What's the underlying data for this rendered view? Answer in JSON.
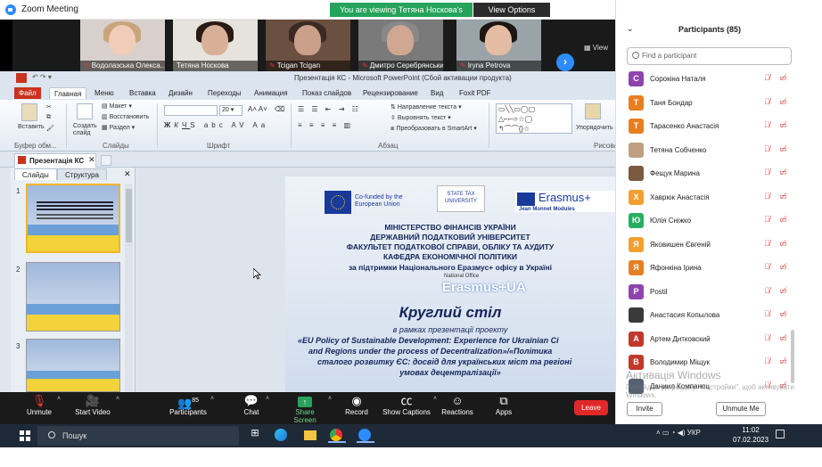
{
  "window": {
    "title": "Zoom Meeting",
    "viewing_banner": "You are viewing Тетяна Носкова's screen",
    "view_options": "View Options"
  },
  "gallery": {
    "tiles": [
      "Водолазська Олекса...",
      "Тетяна Носкова",
      "Tcigan Tcigan",
      "Дмитро Серебрянський",
      "Iryna Petrova"
    ],
    "view_label": "View"
  },
  "ppt": {
    "title": "Презентація КС - Microsoft PowerPoint (Сбой активации продукта)",
    "tabs": [
      "Файл",
      "Главная",
      "Меню",
      "Вставка",
      "Дизайн",
      "Переходы",
      "Анимация",
      "Показ слайдов",
      "Рецензирование",
      "Вид",
      "Foxit PDF"
    ],
    "ribbon": {
      "paste": "Вставить",
      "create_slide": "Создать слайд",
      "layout": "Макет",
      "restore": "Восстановить",
      "section": "Раздел",
      "font_size": "20",
      "text_direction": "Направление текста",
      "align_text": "Выровнять текст",
      "smartart": "Преобразовать в SmartArt",
      "arrange": "Упорядочить",
      "groups": {
        "clipboard": "Буфер обм...",
        "slides": "Слайды",
        "font": "Шрифт",
        "paragraph": "Абзац",
        "drawing": "Рисова"
      }
    },
    "doc_tab": "Презентація КС",
    "pane_tabs": {
      "slides": "Слайды",
      "structure": "Структура"
    },
    "thumb_numbers": [
      "1",
      "2",
      "3"
    ]
  },
  "slide": {
    "eu_badge": "Co-funded by the European Union",
    "university": "STATE TAX UNIVERSITY",
    "erasmus": "Erasmus+",
    "jean_monnet": "Jean Monnet Modules",
    "lines": [
      "МІНІСТЕРСТВО ФІНАНСІВ УКРАЇНИ",
      "ДЕРЖАВНИЙ ПОДАТКОВИЙ УНІВЕРСИТЕТ",
      "ФАКУЛЬТЕТ ПОДАТКОВОЇ СПРАВИ, ОБЛІКУ ТА АУДИТУ",
      "КАФЕДРА ЕКОНОМІЧНОЇ ПОЛІТИКИ",
      "за підтримки Національного Еразмус+ офісу в Україні"
    ],
    "national_office": "National Office",
    "erasmus_ua": "Erasmus+UA",
    "round_table": "Круглий стіл",
    "subtitle": "в рамках презентації проекту",
    "project_lines": [
      "«EU Policy of Sustainable Development: Experience for Ukrainian Ci",
      "and Regions under the process of Decentralization»/«Політика",
      "сталого розвитку ЄС: досвід для українських міст та регіоні",
      "умовах децентралізації»"
    ]
  },
  "participants": {
    "title": "Participants (85)",
    "find_placeholder": "Find a participant",
    "list": [
      {
        "initial": "С",
        "name": "Сорокіна Наталя",
        "color": "#8e44ad"
      },
      {
        "initial": "Т",
        "name": "Таня Бондар",
        "color": "#e67e22"
      },
      {
        "initial": "Т",
        "name": "Тарасенко Анастасія",
        "color": "#e67e22"
      },
      {
        "initial": "",
        "name": "Тетяна Собченко",
        "color": "#c0a080"
      },
      {
        "initial": "",
        "name": "Фещук Марина",
        "color": "#7a5a40"
      },
      {
        "initial": "Х",
        "name": "Хаврюк Анастасія",
        "color": "#f0a030"
      },
      {
        "initial": "Ю",
        "name": "Юлія Сніжко",
        "color": "#27ae60"
      },
      {
        "initial": "Я",
        "name": "Яковишен Євгеній",
        "color": "#f0a030"
      },
      {
        "initial": "Я",
        "name": "Яфонкіна Ірина",
        "color": "#e67e22"
      },
      {
        "initial": "P",
        "name": "Postil",
        "color": "#8e44ad"
      },
      {
        "initial": "",
        "name": "Анастасия Копылова",
        "color": "#3a3a3a"
      },
      {
        "initial": "А",
        "name": "Артем Дитковский",
        "color": "#c0392b"
      },
      {
        "initial": "В",
        "name": "Володимир Міщук",
        "color": "#c0392b"
      },
      {
        "initial": "",
        "name": "Даниил Компанец",
        "color": "#556070"
      }
    ],
    "invite": "Invite",
    "unmute_me": "Unmute Me"
  },
  "watermark": {
    "line1": "Активація Windows",
    "line2": "Перейдіть до розділу \"Настройки\", щоб активувати Windows."
  },
  "toolbar": {
    "unmute": "Unmute",
    "start_video": "Start Video",
    "participants": "Participants",
    "participants_count": "85",
    "chat": "Chat",
    "share_screen": "Share Screen",
    "record": "Record",
    "captions": "Show Captions",
    "reactions": "Reactions",
    "apps": "Apps",
    "leave": "Leave"
  },
  "taskbar": {
    "search": "Пошук",
    "language": "УКР",
    "time": "11:02",
    "date": "07.02.2023"
  }
}
